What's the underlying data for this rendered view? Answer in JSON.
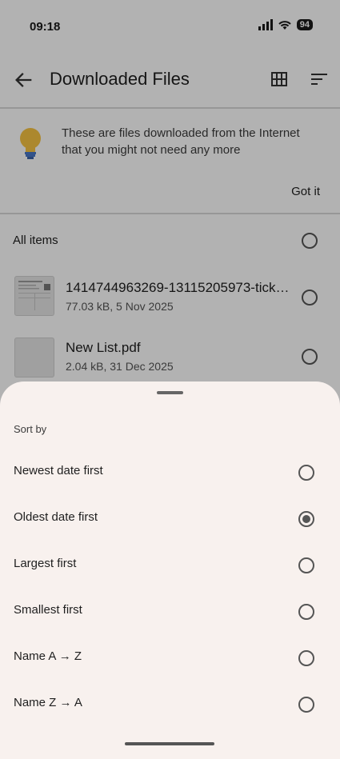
{
  "status_bar": {
    "time": "09:18",
    "battery": "94"
  },
  "app_bar": {
    "title": "Downloaded Files"
  },
  "banner": {
    "text": "These are files downloaded from the Internet that you might not need any more",
    "action": "Got it"
  },
  "list": {
    "select_all_label": "All items",
    "files": [
      {
        "name": "1414744963269-13115205973-ticket…",
        "meta": "77.03 kB, 5 Nov 2025"
      },
      {
        "name": "New List.pdf",
        "meta": "2.04 kB, 31 Dec 2025"
      }
    ]
  },
  "sort_sheet": {
    "title": "Sort by",
    "selected_index": 1,
    "options": [
      "Newest date first",
      "Oldest date first",
      "Largest first",
      "Smallest first",
      "Name A → Z",
      "Name Z → A"
    ]
  }
}
